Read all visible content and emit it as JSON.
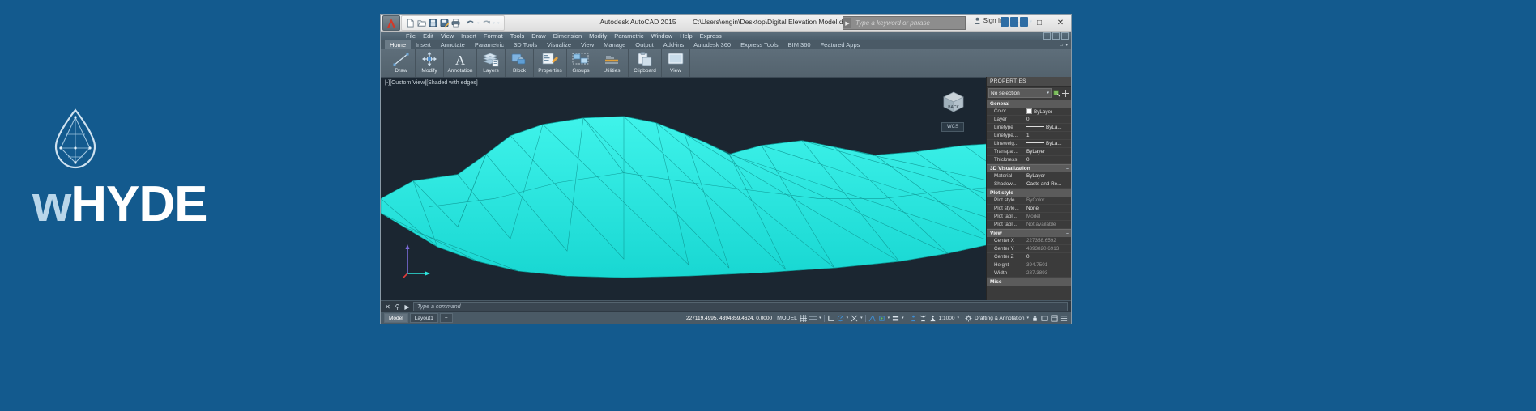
{
  "brand": {
    "word_light": "w",
    "word_bold": "HYDE",
    "logo_name": "water-drop-logo"
  },
  "window": {
    "title_app": "Autodesk AutoCAD 2015",
    "title_file": "C:\\Users\\engin\\Desktop\\Digital Elevation Model.dwg",
    "minimize": "–",
    "maximize": "□",
    "close": "✕",
    "sign_in": "Sign In",
    "infocenter_placeholder": "Type a keyword or phrase",
    "infocenter_arrow": "▶"
  },
  "quick_access": [
    {
      "name": "new-icon",
      "label": "New"
    },
    {
      "name": "open-icon",
      "label": "Open"
    },
    {
      "name": "save-icon",
      "label": "Save"
    },
    {
      "name": "save-as-icon",
      "label": "Save As"
    },
    {
      "name": "plot-icon",
      "label": "Plot"
    },
    {
      "name": "undo-icon",
      "label": "Undo"
    },
    {
      "name": "redo-icon",
      "label": "Redo"
    }
  ],
  "menubar": [
    "File",
    "Edit",
    "View",
    "Insert",
    "Format",
    "Tools",
    "Draw",
    "Dimension",
    "Modify",
    "Parametric",
    "Window",
    "Help",
    "Express"
  ],
  "ribbon_tabs": [
    {
      "label": "Home",
      "active": true
    },
    {
      "label": "Insert",
      "active": false
    },
    {
      "label": "Annotate",
      "active": false
    },
    {
      "label": "Parametric",
      "active": false
    },
    {
      "label": "3D Tools",
      "active": false
    },
    {
      "label": "Visualize",
      "active": false
    },
    {
      "label": "View",
      "active": false
    },
    {
      "label": "Manage",
      "active": false
    },
    {
      "label": "Output",
      "active": false
    },
    {
      "label": "Add-ins",
      "active": false
    },
    {
      "label": "Autodesk 360",
      "active": false
    },
    {
      "label": "Express Tools",
      "active": false
    },
    {
      "label": "BIM 360",
      "active": false
    },
    {
      "label": "Featured Apps",
      "active": false
    }
  ],
  "ribbon_panels": [
    {
      "label": "Draw",
      "icon": "line-icon"
    },
    {
      "label": "Modify",
      "icon": "move-icon"
    },
    {
      "label": "Annotation",
      "icon": "text-a-icon"
    },
    {
      "label": "Layers",
      "icon": "layers-icon"
    },
    {
      "label": "Block",
      "icon": "block-icon"
    },
    {
      "label": "Properties",
      "icon": "properties-icon"
    },
    {
      "label": "Groups",
      "icon": "groups-icon"
    },
    {
      "label": "Utilities",
      "icon": "utilities-icon"
    },
    {
      "label": "Clipboard",
      "icon": "clipboard-icon"
    },
    {
      "label": "View",
      "icon": "view-icon"
    }
  ],
  "viewport": {
    "label": "[-][Custom View][Shaded with edges]",
    "viewcube_face": "BACK",
    "ucs_label": "WCS",
    "model_color": "#2ee8e0"
  },
  "properties": {
    "title": "PROPERTIES",
    "selection": "No selection",
    "groups": [
      {
        "name": "General",
        "rows": [
          {
            "key": "Color",
            "value": "ByLayer",
            "swatch": true
          },
          {
            "key": "Layer",
            "value": "0"
          },
          {
            "key": "Linetype",
            "value": "ByLa...",
            "linetype": true
          },
          {
            "key": "Linetype...",
            "value": "1"
          },
          {
            "key": "Lineweig...",
            "value": "ByLa...",
            "linetype": true
          },
          {
            "key": "Transpar...",
            "value": "ByLayer"
          },
          {
            "key": "Thickness",
            "value": "0"
          }
        ]
      },
      {
        "name": "3D Visualization",
        "rows": [
          {
            "key": "Material",
            "value": "ByLayer"
          },
          {
            "key": "Shadow...",
            "value": "Casts and Re..."
          }
        ]
      },
      {
        "name": "Plot style",
        "rows": [
          {
            "key": "Plot style",
            "value": "ByColor",
            "dim": true
          },
          {
            "key": "Plot style...",
            "value": "None"
          },
          {
            "key": "Plot tabl...",
            "value": "Model",
            "dim": true
          },
          {
            "key": "Plot tabl...",
            "value": "Not available",
            "dim": true
          }
        ]
      },
      {
        "name": "View",
        "rows": [
          {
            "key": "Center X",
            "value": "227358.6592",
            "dim": true
          },
          {
            "key": "Center Y",
            "value": "4393820.6913",
            "dim": true
          },
          {
            "key": "Center Z",
            "value": "0"
          },
          {
            "key": "Height",
            "value": "394.7501",
            "dim": true
          },
          {
            "key": "Width",
            "value": "287.3893",
            "dim": true
          }
        ]
      },
      {
        "name": "Misc",
        "rows": []
      }
    ]
  },
  "command_line": {
    "placeholder": "Type a command",
    "close_icon": "✕",
    "search_icon": "⚲",
    "prompt": "▶"
  },
  "status_bar": {
    "tabs": [
      {
        "label": "Model",
        "active": true
      },
      {
        "label": "Layout1",
        "active": false
      },
      {
        "label": "+",
        "active": false
      }
    ],
    "coordinates": "227119.4995, 4394859.4624, 0.0000",
    "space": "MODEL",
    "scale": "1:1000",
    "workspace": "Drafting & Annotation",
    "icons": [
      "grid-icon",
      "snap-icon",
      "ortho-icon",
      "polar-icon",
      "osnap-icon",
      "otrack-icon",
      "lineweight-icon",
      "annotation-visibility-icon",
      "autoscale-icon",
      "annotation-scale-icon"
    ]
  }
}
